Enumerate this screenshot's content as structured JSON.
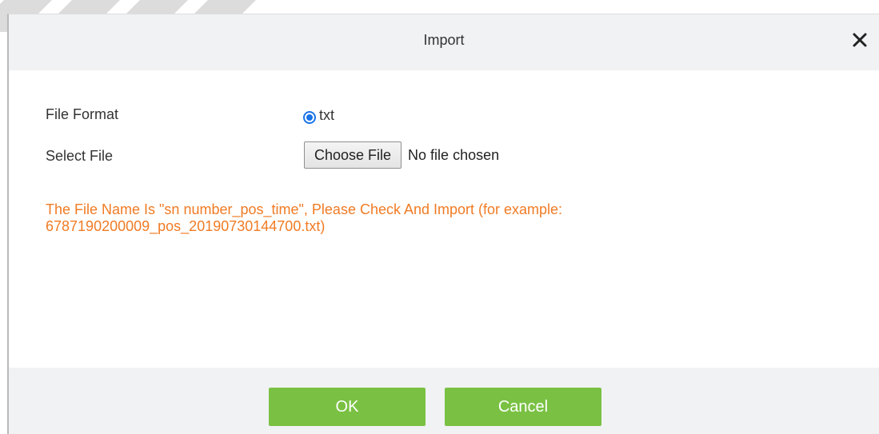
{
  "dialog": {
    "title": "Import",
    "close_icon": "close-icon"
  },
  "form": {
    "file_format_label": "File Format",
    "file_format_option": "txt",
    "select_file_label": "Select File",
    "choose_file_button": "Choose File",
    "file_status": "No file chosen"
  },
  "hint": {
    "text": "The File Name Is \"sn number_pos_time\", Please Check And Import (for example: 6787190200009_pos_20190730144700.txt)",
    "color": "#f07b24"
  },
  "footer": {
    "ok_label": "OK",
    "cancel_label": "Cancel",
    "button_color": "#7ac143"
  }
}
